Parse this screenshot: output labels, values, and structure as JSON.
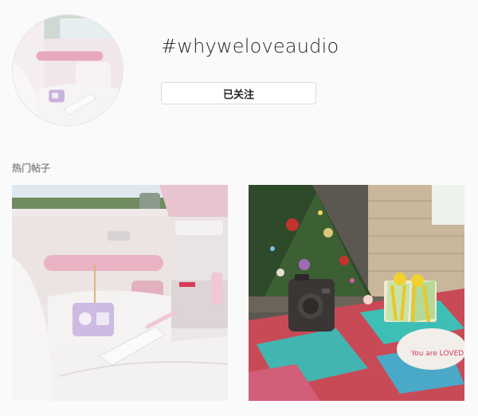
{
  "header": {
    "hashtag": "#whyweloveaudio",
    "follow_label": "已关注"
  },
  "top_posts": {
    "section_label": "热门帖子",
    "posts": [
      {
        "image_alt": "Pink retro car interior with lavender mini radio on white seat"
      },
      {
        "image_alt": "Black mini speaker on colorful woven mat in front of Christmas tree"
      }
    ],
    "stone_text": "You are LOVED"
  },
  "colors": {
    "background": "#fafafa",
    "text_primary": "#262626",
    "text_secondary": "#8e8e8e",
    "border": "#dbdbdb"
  }
}
